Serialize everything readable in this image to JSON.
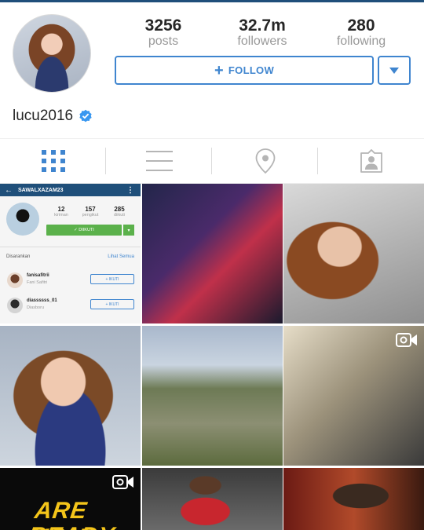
{
  "profile": {
    "username": "lucu2016",
    "verified": true
  },
  "stats": {
    "posts": {
      "value": "3256",
      "label": "posts"
    },
    "followers": {
      "value": "32.7m",
      "label": "followers"
    },
    "following": {
      "value": "280",
      "label": "following"
    }
  },
  "actions": {
    "follow_label": "FOLLOW",
    "follow_icon": "plus-icon",
    "dropdown_icon": "chevron-down-icon"
  },
  "tabs": [
    {
      "name": "grid-view",
      "icon": "grid-icon",
      "active": true
    },
    {
      "name": "list-view",
      "icon": "list-icon",
      "active": false
    },
    {
      "name": "location-view",
      "icon": "location-pin-icon",
      "active": false
    },
    {
      "name": "tagged-view",
      "icon": "tagged-person-icon",
      "active": false
    }
  ],
  "colors": {
    "accent": "#3f85cf",
    "active_tab": "#3f85cf",
    "inactive_tab": "#b5b5b5",
    "verified": "#3897f0",
    "mini_header": "#1f4f7a",
    "mini_follow": "#5bb14b",
    "video_badge": "#ffffff"
  },
  "grid_post_1": {
    "header_username": "SAWALXAZAM23",
    "stats": [
      {
        "value": "12",
        "label": "kiriman"
      },
      {
        "value": "157",
        "label": "pengikut"
      },
      {
        "value": "285",
        "label": "diikuti"
      }
    ],
    "follow_label": "✓ DIIKUTI",
    "suggested_label": "Disarankan",
    "see_all_label": "Lihat Semua",
    "suggestions": [
      {
        "username": "fanisafitrii",
        "name": "Fani Safitri",
        "button": "+ IKUTI"
      },
      {
        "username": "diassssss_01",
        "name": "Diasboru",
        "button": "+ IKUTI"
      }
    ]
  },
  "grid_post_7": {
    "text_line1": "ARE YOU",
    "text_line2": "READY"
  },
  "video_posts": [
    "grid-post-6",
    "grid-post-7"
  ]
}
